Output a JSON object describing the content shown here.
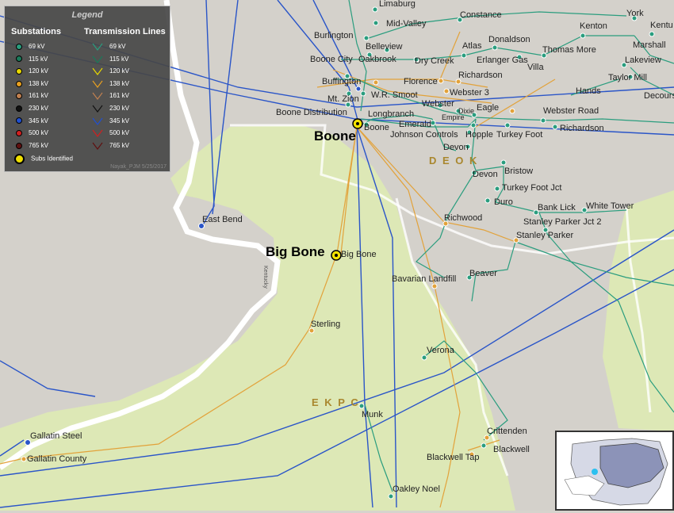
{
  "legend": {
    "title": "Legend",
    "substations_header": "Substations",
    "lines_header": "Transmission Lines",
    "substation_items": [
      {
        "label": "69 kV",
        "color": "#2a9d7e"
      },
      {
        "label": "115 kV",
        "color": "#1a7a5a"
      },
      {
        "label": "120 kV",
        "color": "#e8d800"
      },
      {
        "label": "138 kV",
        "color": "#e8a020"
      },
      {
        "label": "161 kV",
        "color": "#c08050"
      },
      {
        "label": "230 kV",
        "color": "#111111"
      },
      {
        "label": "345 kV",
        "color": "#2050d0"
      },
      {
        "label": "500 kV",
        "color": "#d02020"
      },
      {
        "label": "765 kV",
        "color": "#601010"
      },
      {
        "label": "Subs Identified",
        "color": "#f0e000"
      }
    ],
    "line_items": [
      {
        "label": "69 kV",
        "color": "#2a9d7e"
      },
      {
        "label": "115 kV",
        "color": "#1a7a5a"
      },
      {
        "label": "120 kV",
        "color": "#e8d800"
      },
      {
        "label": "138 kV",
        "color": "#e8a020"
      },
      {
        "label": "161 kV",
        "color": "#c08050"
      },
      {
        "label": "230 kV",
        "color": "#111111"
      },
      {
        "label": "345 kV",
        "color": "#2050d0"
      },
      {
        "label": "500 kV",
        "color": "#d02020"
      },
      {
        "label": "765 kV",
        "color": "#601010"
      }
    ],
    "credit": "Nayak_PJM 5/25/2017"
  },
  "regions": {
    "duke": "D E O K",
    "ekpc": "E K P C"
  },
  "highlighted": {
    "boone": "Boone",
    "big_bone": "Big Bone"
  },
  "substations": [
    "Limaburg",
    "Mid-Valley",
    "Constance",
    "York",
    "Kentu",
    "Burlington",
    "Belleview",
    "Kenton",
    "Marshall",
    "Boone City",
    "Oakbrook",
    "Dry Creek",
    "Atlas",
    "Donaldson",
    "Erlanger Gas",
    "Thomas More",
    "Lakeview",
    "Villa",
    "Taylor Mill",
    "Buffington",
    "Florence",
    "Richardson",
    "Webster 3",
    "Hands",
    "Decours",
    "Mt. Zion",
    "W.R. Smoot",
    "Webster",
    "Dixie",
    "Eagle",
    "Webster Road",
    "Boone Distribution",
    "Longbranch",
    "Empire",
    "Emerald",
    "Boone",
    "Richardson",
    "Johnson Controls",
    "Hopple",
    "Turkey Foot",
    "Devon",
    "Devon",
    "Bristow",
    "Turkey Foot Jct",
    "Duro",
    "Bank Lick",
    "White Tower",
    "Stanley Parker Jct 2",
    "Richwood",
    "Stanley Parker",
    "East Bend",
    "Big Bone",
    "Bavarian Landfill",
    "Beaver",
    "Sterling",
    "Verona",
    "Munk",
    "Crittenden",
    "Blackwell",
    "Gallatin Steel",
    "Gallatin County",
    "Blackwell Tap",
    "Oakley Noel"
  ],
  "colors": {
    "land": "#d6d3cd",
    "ekpc_green": "#dbe8b8",
    "river": "#ffffff",
    "county": "#ffffff"
  }
}
